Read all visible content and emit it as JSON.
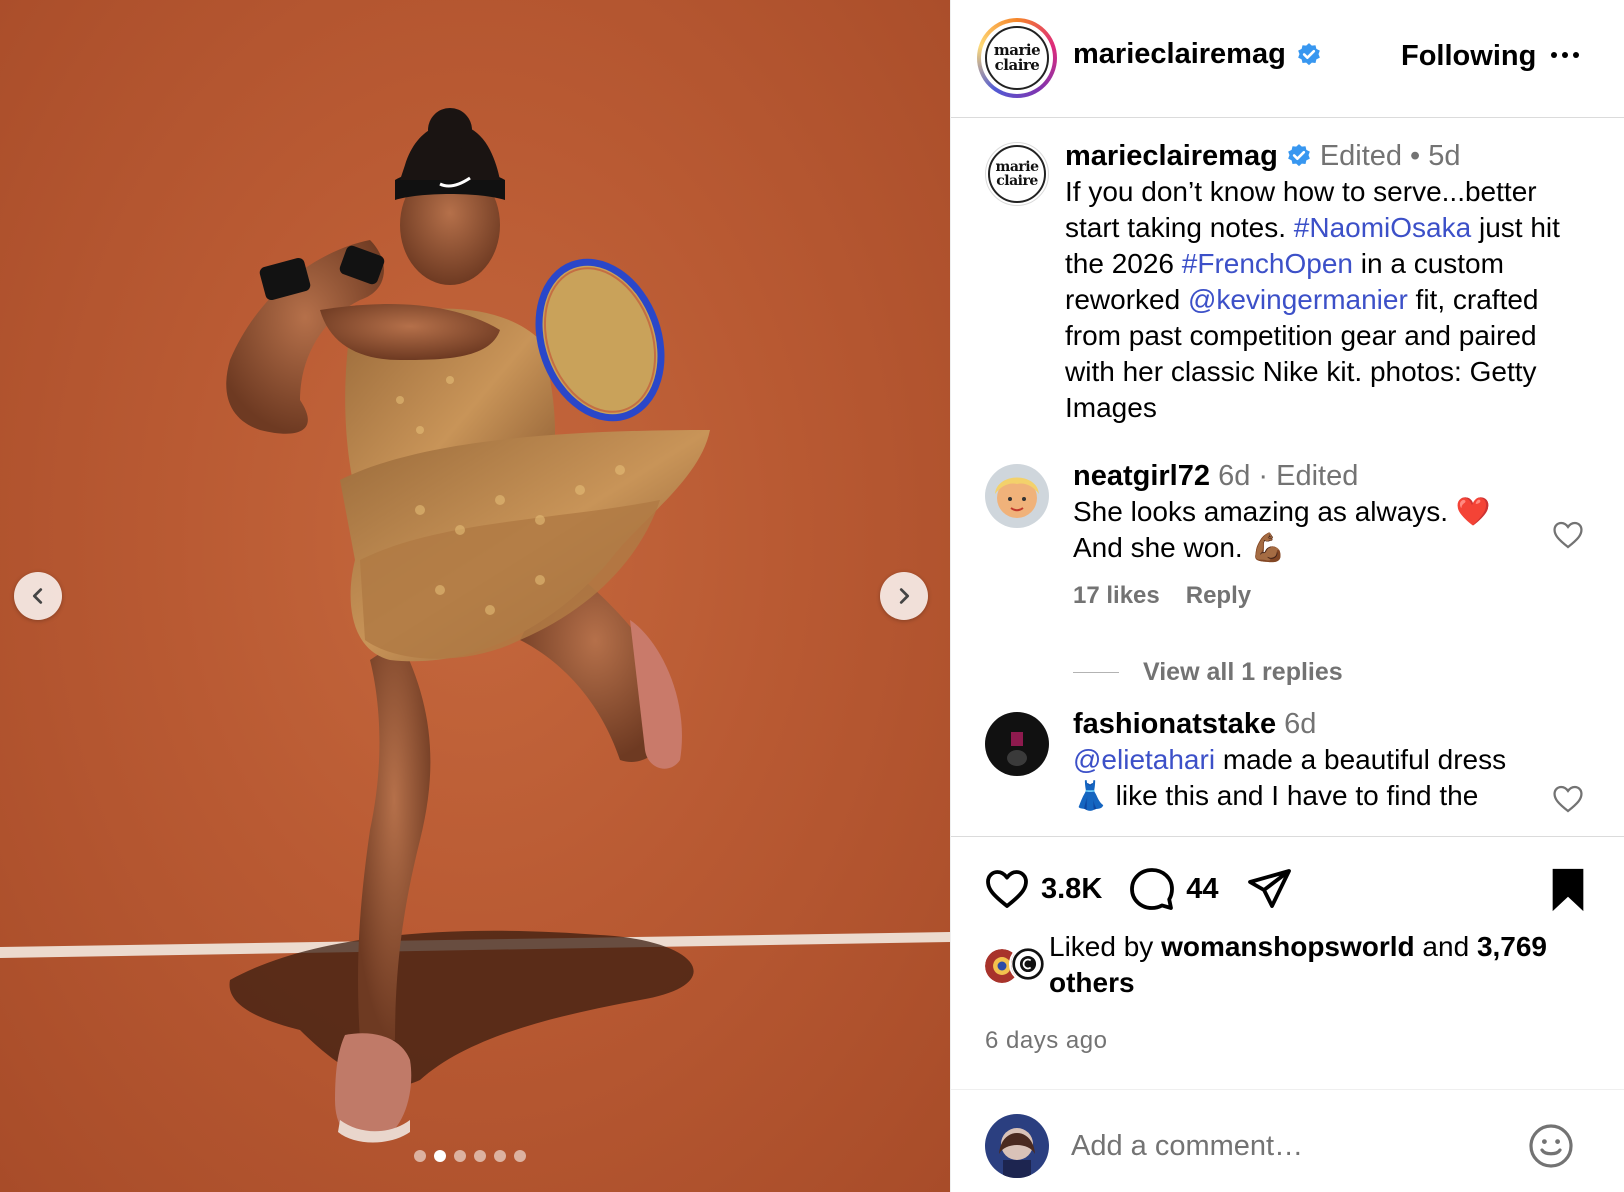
{
  "post": {
    "author": "marieclairemag",
    "logo_line1": "marie",
    "logo_line2": "claire",
    "follow_status": "Following",
    "caption": {
      "edited": "Edited",
      "sep": "•",
      "age": "5d",
      "t1": "If you don’t know how to serve...better start taking notes. ",
      "tag1": "#NaomiOsaka",
      "t2": " just hit the 2026 ",
      "tag2": "#FrenchOpen",
      "t3": " in a custom reworked ",
      "tag3": "@kevingermanier",
      "t4": " fit, crafted from past competition gear and paired with her classic Nike kit. photos: Getty Images"
    }
  },
  "comments": [
    {
      "user": "neatgirl72",
      "age": "6d",
      "edited": "· Edited",
      "line1": "She looks amazing as always. ❤️",
      "line2": "And she won. 💪🏾",
      "likes": "17 likes",
      "reply": "Reply",
      "view_replies": "View all 1 replies"
    },
    {
      "user": "fashionatstake",
      "age": "6d",
      "mention": "@elietahari",
      "line1_rest": " made a beautiful dress",
      "line2": "👗 like this and I have to find the"
    }
  ],
  "actions": {
    "like_count": "3.8K",
    "comment_count": "44"
  },
  "liked_by": {
    "prefix": "Liked by ",
    "user": "womanshopsworld",
    "and": " and ",
    "others": "3,769 others"
  },
  "time_ago": "6 days ago",
  "add_comment_placeholder": "Add a comment…",
  "carousel": {
    "total": 6,
    "active_index": 1
  },
  "colors": {
    "accent_link": "#3c50c8",
    "verified": "#3897f0",
    "clay": "#b95a33"
  }
}
